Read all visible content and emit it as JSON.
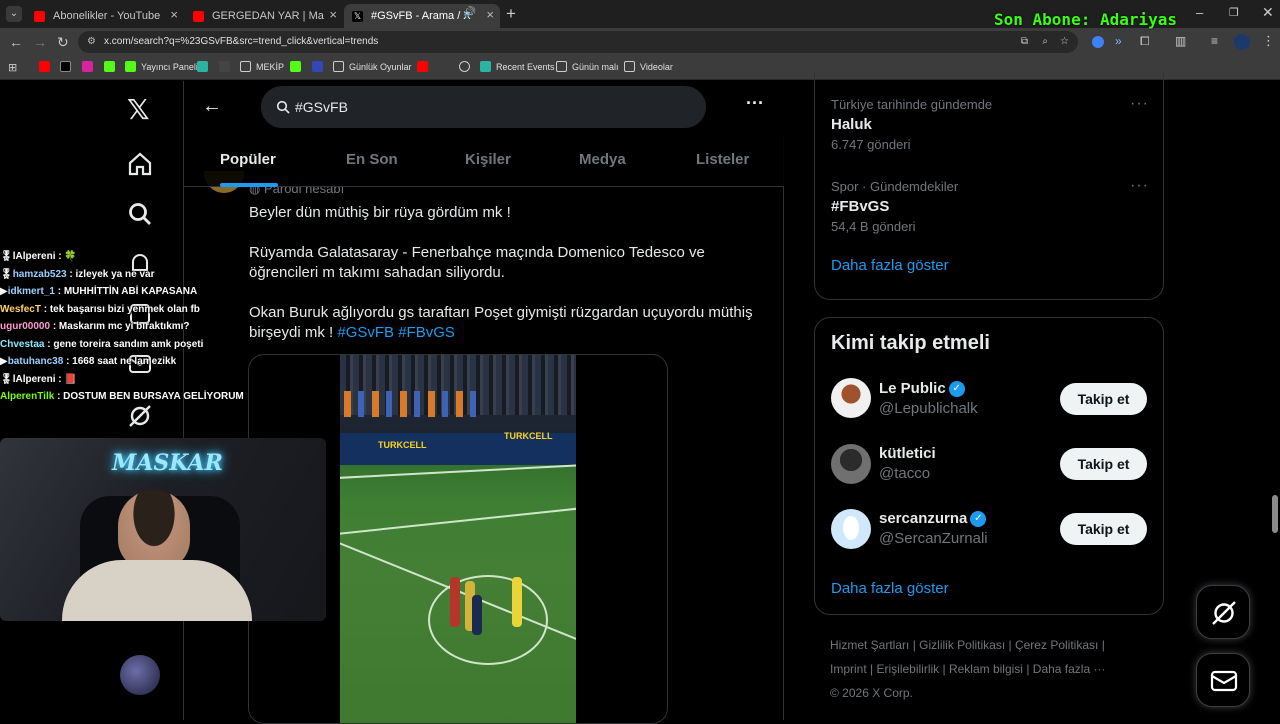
{
  "browser": {
    "tabs": [
      {
        "title": "Abonelikler - YouTube",
        "favicon": "youtube-icon",
        "color": "#ff0000"
      },
      {
        "title": "GERGEDAN YAR | Madara Olduğ",
        "favicon": "youtube-icon",
        "color": "#ff0000"
      },
      {
        "title": "#GSvFB - Arama / X",
        "favicon": "x-icon",
        "color": "#ffffff",
        "active": true
      }
    ],
    "new_tab": "+",
    "url": "x.com/search?q=%23GSvFB&src=trend_click&vertical=trends",
    "bookmarks": [
      {
        "label": "",
        "icon": "youtube-icon"
      },
      {
        "label": "",
        "icon": "x-icon"
      },
      {
        "label": "",
        "icon": "instagram-icon"
      },
      {
        "label": "",
        "icon": "kick-icon"
      },
      {
        "label": "Yayıncı Paneli",
        "icon": "kick-icon"
      },
      {
        "label": "",
        "icon": "app-icon"
      },
      {
        "label": "",
        "icon": "terminal-icon"
      },
      {
        "label": "MEKİP",
        "icon": "folder-icon"
      },
      {
        "label": "",
        "icon": "kick-icon"
      },
      {
        "label": "",
        "icon": "app-icon"
      },
      {
        "label": "Günlük Oyunlar",
        "icon": "folder-icon"
      },
      {
        "label": "",
        "icon": "youtube-icon"
      },
      {
        "label": "",
        "icon": "chatgpt-icon"
      },
      {
        "label": "Recent Events",
        "icon": "app-icon"
      },
      {
        "label": "Günün malı",
        "icon": "folder-icon"
      },
      {
        "label": "Videolar",
        "icon": "folder-icon"
      }
    ]
  },
  "overlay": {
    "text": "Son Abone: Adariyas"
  },
  "x": {
    "search": {
      "query": "#GSvFB"
    },
    "tabs": [
      "Popüler",
      "En Son",
      "Kişiler",
      "Medya",
      "Listeler"
    ],
    "tweet": {
      "parody_label": "Parodi hesabı",
      "paragraphs": [
        "Beyler dün müthiş bir rüya gördüm mk !",
        "Rüyamda Galatasaray - Fenerbahçe maçında Domenico Tedesco ve öğrencileri m takımı sahadan siliyordu.",
        "Okan Buruk ağlıyordu gs taraftarı Poşet giymişti rüzgardan uçuyordu müthiş birşeydi mk !"
      ],
      "hashtags": [
        "#GSvFB",
        "#FBvGS"
      ],
      "media_ads": [
        "TURKCELL",
        "TURKCELL"
      ]
    },
    "trends": [
      {
        "context": "Türkiye tarihinde gündemde",
        "name": "Haluk",
        "posts": "6.747 gönderi"
      },
      {
        "context": "Spor · Gündemdekiler",
        "name": "#FBvGS",
        "posts": "54,4 B gönderi"
      }
    ],
    "show_more": "Daha fazla göster",
    "who_to_follow": {
      "title": "Kimi takip etmeli",
      "users": [
        {
          "name": "Le Public",
          "handle": "@Lepublichalk",
          "verified": true,
          "button": "Takip et"
        },
        {
          "name": "kütletici",
          "handle": "@tacco",
          "verified": false,
          "button": "Takip et"
        },
        {
          "name": "sercanzurna",
          "handle": "@SercanZurnali",
          "verified": true,
          "button": "Takip et"
        }
      ],
      "show_more": "Daha fazla göster"
    },
    "footer": {
      "links": [
        "Hizmet Şartları",
        "Gizlilik Politikası",
        "Çerez Politikası",
        "Imprint",
        "Erişilebilirlik",
        "Reklam bilgisi",
        "Daha fazla ···"
      ],
      "copyright": "© 2026 X Corp."
    }
  },
  "chat": [
    {
      "user": "lAlpereni",
      "text": ": 🍀",
      "color": "#ffffff"
    },
    {
      "user": "hamzab523",
      "text": ": izleyek ya ne var",
      "color": "#9ad0ff"
    },
    {
      "user": "idkmert_1",
      "text": ": MUHHİTTİN ABİ KAPASANA",
      "color": "#9ad0ff"
    },
    {
      "user": "WesfecT",
      "text": ": tek başarısı bizi yenmek olan fb",
      "color": "#ffd36b"
    },
    {
      "user": "ugur00000",
      "text": ": Maskarım mc yi bıraktıkmı?",
      "color": "#ff9ad1"
    },
    {
      "user": "Chvestaa",
      "text": ": gene toreira sandım amk poşeti",
      "color": "#8fe6ff"
    },
    {
      "user": "batuhanc38",
      "text": ": 1668 saat ne lan ezikk",
      "color": "#9ad0ff"
    },
    {
      "user": "lAlpereni",
      "text": ": 📕",
      "color": "#ffffff"
    },
    {
      "user": "AlperenTilk",
      "text": ": DOSTUM BEN BURSAYA GELİYORUM",
      "color": "#7CFC00"
    }
  ],
  "webcam": {
    "neon_sign": "MASKAR"
  }
}
